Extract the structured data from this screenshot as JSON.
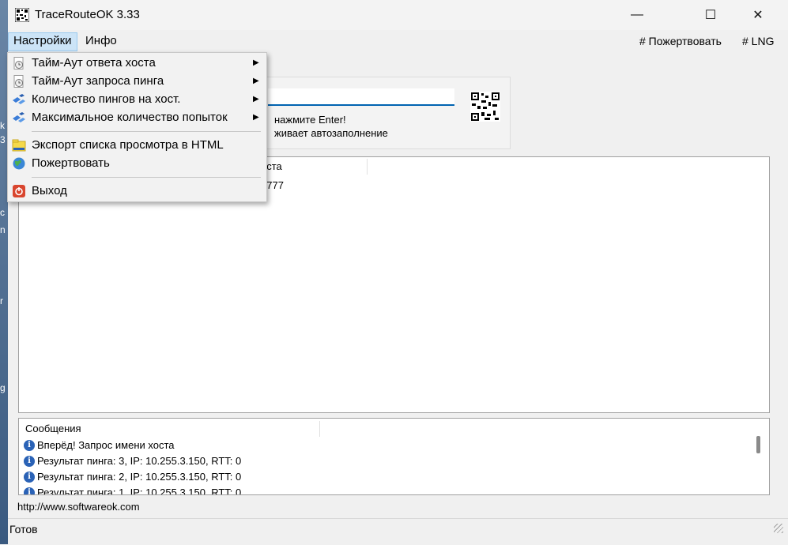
{
  "window": {
    "title": "TraceRouteOK 3.33",
    "minimize_glyph": "—",
    "maximize_glyph": "☐",
    "close_glyph": "✕"
  },
  "menubar": {
    "settings": "Настройки",
    "info": "Инфо",
    "donate": "# Пожертвовать",
    "lng": "# LNG"
  },
  "settings_menu": {
    "items": [
      {
        "label": "Тайм-Аут ответа хоста",
        "icon": "clock-page-icon",
        "submenu": true
      },
      {
        "label": "Тайм-Аут запроса пинга",
        "icon": "clock-page-icon",
        "submenu": true
      },
      {
        "label": "Количество пингов на хост.",
        "icon": "network-icon",
        "submenu": true
      },
      {
        "label": "Максимальное количество попыток",
        "icon": "network-icon",
        "submenu": true
      },
      {
        "label": "Экспорт списка просмотра в HTML",
        "icon": "folder-export-icon",
        "submenu": false
      },
      {
        "label": "Пожертвовать",
        "icon": "globe-icon",
        "submenu": false
      },
      {
        "label": "Выход",
        "icon": "power-icon",
        "submenu": false
      }
    ]
  },
  "input_panel": {
    "hint_line1": "нажмите Enter!",
    "hint_line2": "живает автозаполнение",
    "input_value": ""
  },
  "results": {
    "column_header_partial": "оста",
    "row_value_partial": "o777"
  },
  "messages": {
    "header": "Сообщения",
    "rows": [
      "Вперёд! Запрос имени хоста",
      "Результат пинга: 3, IP: 10.255.3.150, RTT: 0",
      "Результат пинга: 2, IP: 10.255.3.150, RTT: 0",
      "Результат пинга: 1, IP: 10.255.3.150, RTT: 0"
    ]
  },
  "footer": {
    "url": "http://www.softwareok.com",
    "status": "Готов"
  },
  "desktop_edge_glyphs": [
    "k",
    "3",
    "c",
    "n",
    "r",
    "g"
  ]
}
